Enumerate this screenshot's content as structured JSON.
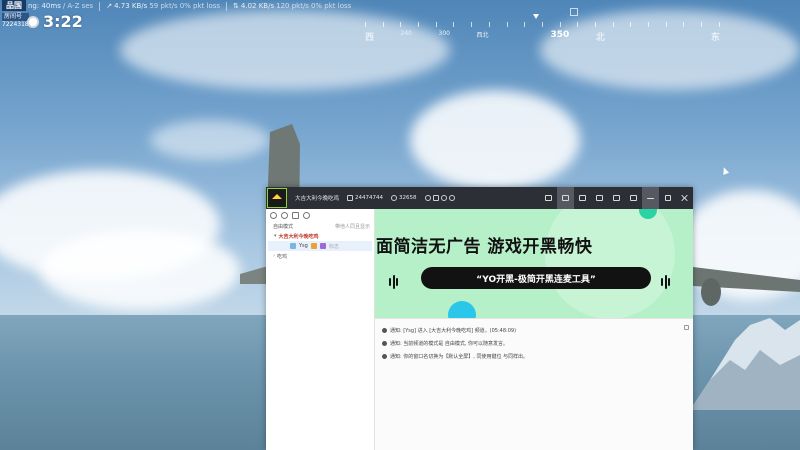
{
  "hud": {
    "logo": "品国",
    "ping": "ng: 40ms",
    "region": "/ A-Z ses",
    "upload_speed": "4.73 KB/s",
    "upload_pkt": "59 pkt/s",
    "upload_loss": "0% pkt loss",
    "download_speed": "4.02 KB/s",
    "download_pkt": "120 pkt/s",
    "download_loss": "0% pkt loss",
    "room_label": "房间号",
    "room_number": "7224318",
    "timer": "3:22",
    "compass_labels": [
      "西",
      "240",
      "300",
      "西北",
      "北",
      "350",
      "北",
      "东"
    ]
  },
  "app": {
    "room_name": "大吉大利今晚吃鸡",
    "room_id": "24474744",
    "member_count": "32658",
    "sidebar": {
      "mode_label": "自由模式",
      "mode_action": "带他人同且显示",
      "channel_name": "大吉大利今晚吃鸡",
      "user_name": "Ysg",
      "user_extra": "标志",
      "sub_channel": "吃鸡"
    },
    "banner": {
      "title": "面简洁无广告  游戏开黑畅快",
      "tagline": "“YO开黑-极简开黑连麦工具”"
    },
    "log": [
      "通知: [Ysg] 进入 [大吉大利今晚吃鸡] 频道。(05:48:09)",
      "通知: 当前频道的模式是 自由模式, 你可以随意发言。",
      "通知: 你的窗口名切换为【默认全屏】, 同使用键位 与同样出。"
    ]
  }
}
